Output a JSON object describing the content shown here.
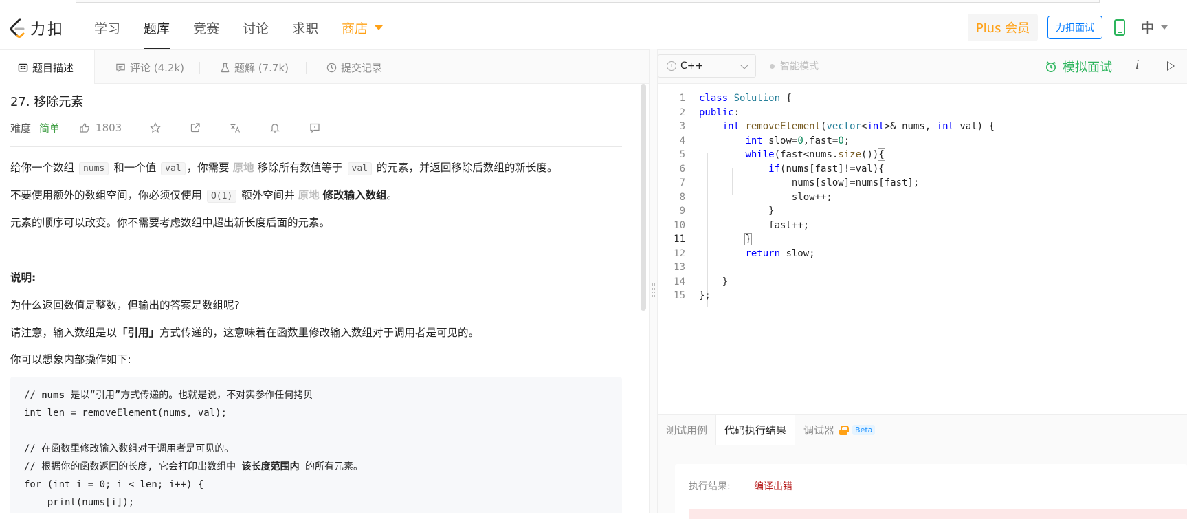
{
  "nav": {
    "logo_text": "力扣",
    "links": [
      "学习",
      "题库",
      "竞赛",
      "讨论",
      "求职",
      "商店"
    ],
    "plus_label": "Plus 会员",
    "interview_label": "力扣面试",
    "lang_label": "中"
  },
  "tabs": {
    "description": "题目描述",
    "comments": "评论 (4.2k)",
    "solutions": "题解 (7.7k)",
    "submissions": "提交记录"
  },
  "problem": {
    "title": "27. 移除元素",
    "difficulty_label": "难度",
    "difficulty": "简单",
    "likes": "1803",
    "p1_a": "给你一个数组",
    "p1_code1": "nums",
    "p1_b": "和一个值",
    "p1_code2": "val",
    "p1_c": "，你需要",
    "p1_gray": "原地",
    "p1_d": "移除所有数值等于",
    "p1_code3": "val",
    "p1_e": "的元素，并返回移除后数组的新长度。",
    "p2_a": "不要使用额外的数组空间，你必须仅使用",
    "p2_code": "O(1)",
    "p2_b": "额外空间并",
    "p2_gray": "原地",
    "p2_bold": "修改输入数组",
    "p2_c": "。",
    "p3": "元素的顺序可以改变。你不需要考虑数组中超出新长度后面的元素。",
    "note_title": "说明:",
    "p4": "为什么返回数值是整数，但输出的答案是数组呢?",
    "p5_a": "请注意，输入数组是以",
    "p5_bold": "「引用」",
    "p5_b": "方式传递的，这意味着在函数里修改输入数组对于调用者是可见的。",
    "p6": "你可以想象内部操作如下:",
    "code_lines": [
      "// nums 是以“引用”方式传递的。也就是说，不对实参作任何拷贝",
      "int len = removeElement(nums, val);",
      "",
      "// 在函数里修改输入数组对于调用者是可见的。",
      "// 根据你的函数返回的长度, 它会打印出数组中 该长度范围内 的所有元素。",
      "for (int i = 0; i < len; i++) {",
      "    print(nums[i]);"
    ]
  },
  "editor": {
    "language": "C++",
    "smart_mode": "智能模式",
    "mock_label": "模拟面试",
    "info_label": "i",
    "line_numbers": [
      "1",
      "2",
      "3",
      "4",
      "5",
      "6",
      "7",
      "8",
      "9",
      "10",
      "11",
      "12",
      "13",
      "14",
      "15"
    ]
  },
  "results": {
    "tab_testcase": "测试用例",
    "tab_result": "代码执行结果",
    "tab_debugger": "调试器",
    "beta": "Beta",
    "result_label": "执行结果:",
    "result_value": "编译出错"
  }
}
